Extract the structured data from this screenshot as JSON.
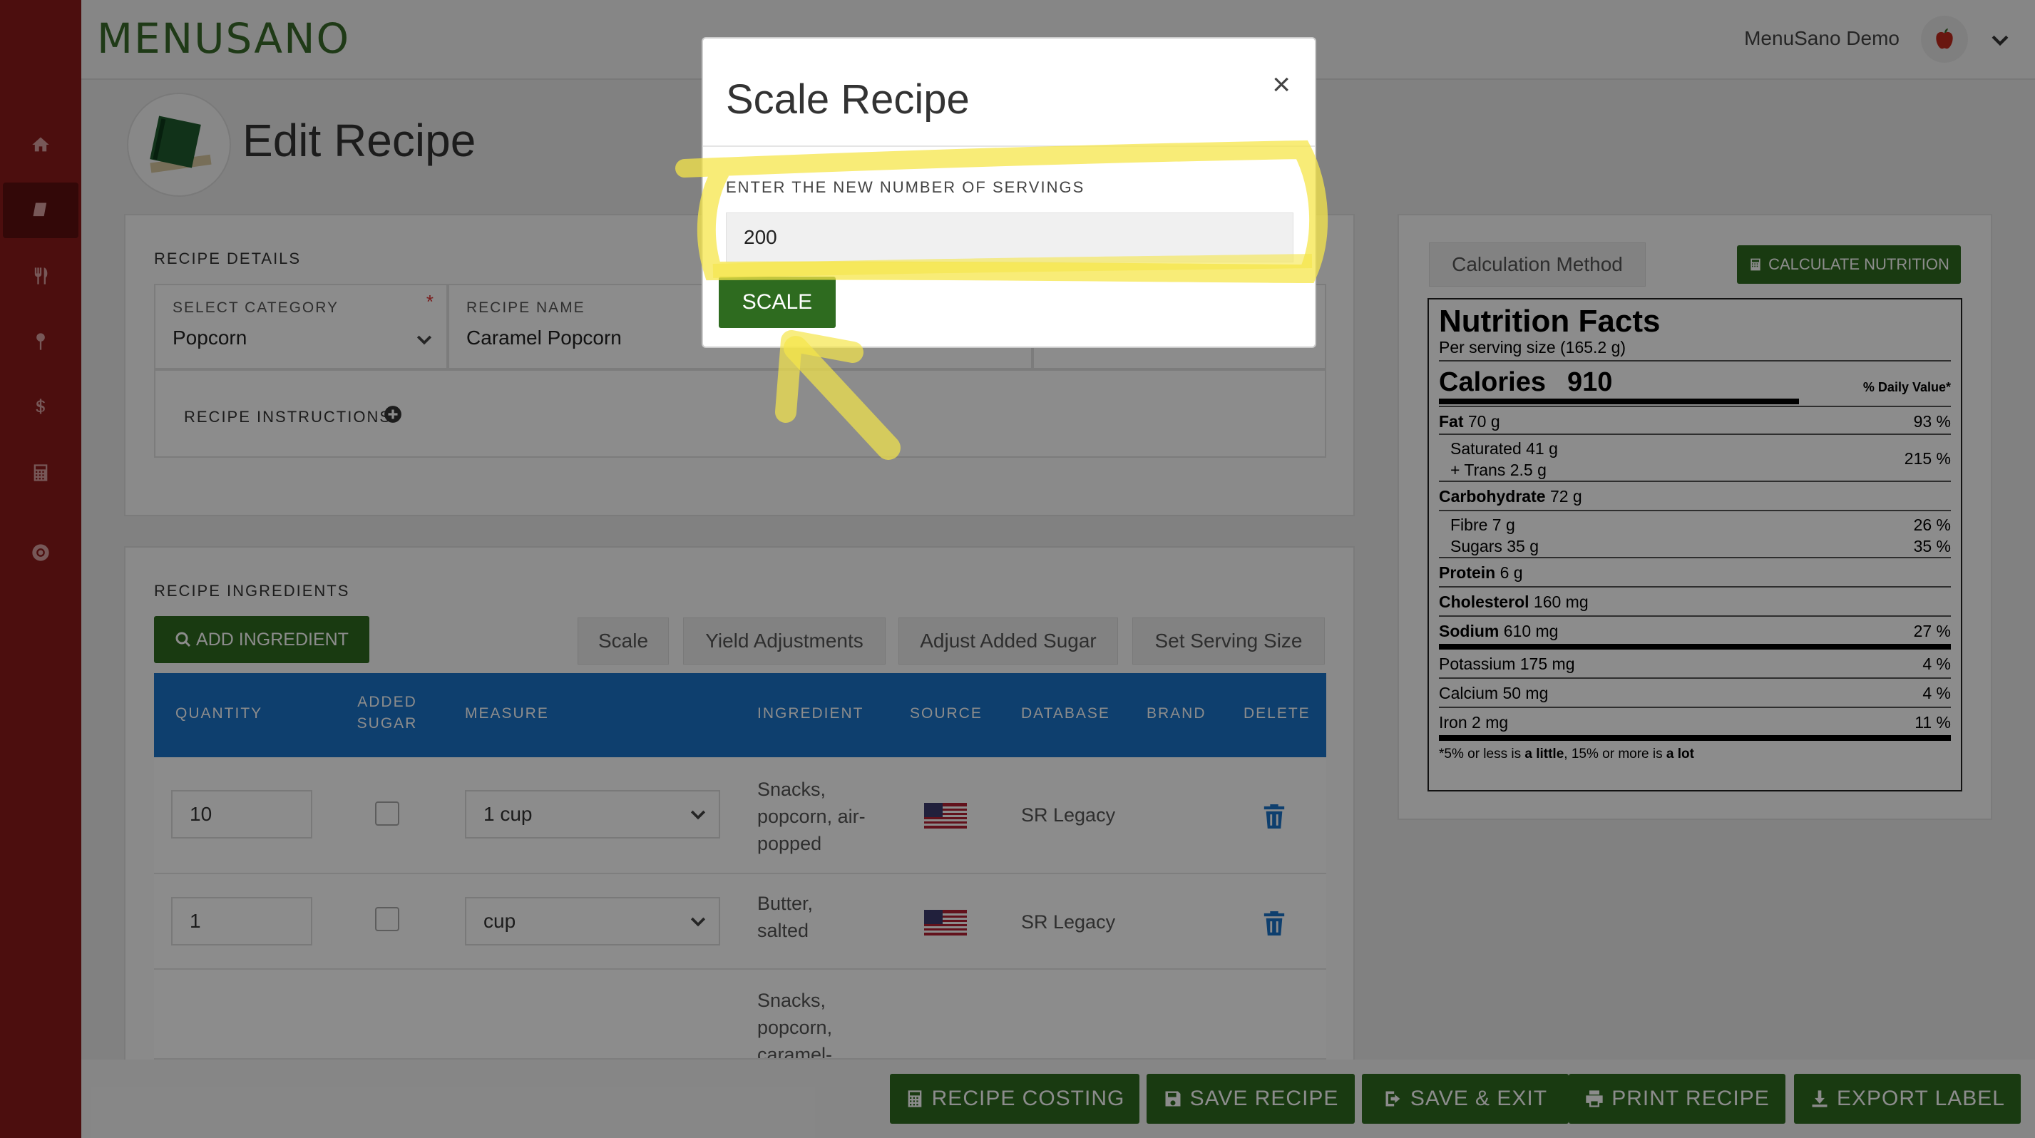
{
  "header": {
    "brand": "MENUSANO",
    "user_name": "MenuSano Demo"
  },
  "sidebar": {
    "items": [
      {
        "icon": "home-icon"
      },
      {
        "icon": "book-icon",
        "active": true
      },
      {
        "icon": "utensils-icon"
      },
      {
        "icon": "pin-icon"
      },
      {
        "icon": "dollar-icon"
      },
      {
        "icon": "calculator-icon"
      },
      {
        "icon": "lifebuoy-icon"
      }
    ]
  },
  "page": {
    "title": "Edit Recipe"
  },
  "recipe_details": {
    "section_label": "RECIPE DETAILS",
    "category_label": "SELECT CATEGORY",
    "category_value": "Popcorn",
    "name_label": "RECIPE NAME",
    "name_value": "Caramel Popcorn",
    "instructions_label": "RECIPE INSTRUCTIONS"
  },
  "ingredients": {
    "section_label": "RECIPE INGREDIENTS",
    "add_button": "ADD INGREDIENT",
    "tools": [
      "Scale",
      "Yield Adjustments",
      "Adjust Added Sugar",
      "Set Serving Size"
    ],
    "columns": [
      "QUANTITY",
      "ADDED SUGAR",
      "MEASURE",
      "INGREDIENT",
      "SOURCE",
      "DATABASE",
      "BRAND",
      "DELETE"
    ],
    "rows": [
      {
        "quantity": "10",
        "measure": "1 cup",
        "ingredient": "Snacks, popcorn, air-popped",
        "database": "SR Legacy"
      },
      {
        "quantity": "1",
        "measure": "cup",
        "ingredient": "Butter, salted",
        "database": "SR Legacy"
      },
      {
        "quantity": "",
        "measure": "",
        "ingredient": "Snacks, popcorn, caramel-",
        "database": ""
      }
    ]
  },
  "nutrition": {
    "method_tab": "Calculation Method",
    "calc_button": "CALCULATE NUTRITION",
    "title": "Nutrition Facts",
    "serving": "Per serving size (165.2 g)",
    "calories_label": "Calories",
    "calories_value": "910",
    "daily_value_label": "% Daily Value*",
    "fat": "Fat",
    "fat_amt": "70 g",
    "fat_pct": "93 %",
    "saturated": "Saturated 41 g",
    "trans": "+ Trans 2.5 g",
    "sat_pct": "215 %",
    "carb": "Carbohydrate",
    "carb_amt": "72 g",
    "fibre": "Fibre 7 g",
    "fibre_pct": "26 %",
    "sugars": "Sugars 35 g",
    "sugars_pct": "35 %",
    "protein": "Protein",
    "protein_amt": "6 g",
    "cholesterol": "Cholesterol",
    "cholesterol_amt": "160 mg",
    "sodium": "Sodium",
    "sodium_amt": "610 mg",
    "sodium_pct": "27 %",
    "potassium": "Potassium 175 mg",
    "potassium_pct": "4 %",
    "calcium": "Calcium 50 mg",
    "calcium_pct": "4 %",
    "iron": "Iron 2 mg",
    "iron_pct": "11 %",
    "footnote_a": "*5% or less is ",
    "footnote_b": "a little",
    "footnote_c": ", 15% or more is ",
    "footnote_d": "a lot"
  },
  "bottom_actions": {
    "costing": "RECIPE COSTING",
    "save": "SAVE RECIPE",
    "save_exit": "SAVE & EXIT",
    "print": "PRINT RECIPE",
    "export": "EXPORT LABEL"
  },
  "modal": {
    "title": "Scale Recipe",
    "close": "×",
    "label": "ENTER THE NEW NUMBER OF SERVINGS",
    "input_value": "200",
    "scale_button": "SCALE"
  },
  "colors": {
    "sidebar": "#8b1a1a",
    "brand_green": "#2e6b1f",
    "table_header": "#1a73c8",
    "highlight": "#f5e64a"
  }
}
